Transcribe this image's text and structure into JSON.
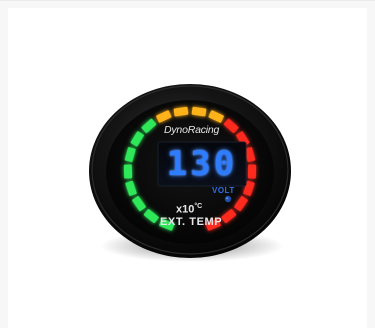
{
  "gauge": {
    "brand": "DynoRacing",
    "reading": "130",
    "unit": "VOLT",
    "scale_prefix": "x10",
    "scale_unit": "°C",
    "name": "EXT. TEMP"
  },
  "colors": {
    "segment_green": "#2ee85a",
    "segment_yellow": "#ffb21a",
    "segment_red": "#ff2a1e",
    "display_blue": "#2e7cff",
    "bezel": "#0d0d0d"
  },
  "segments": [
    {
      "zone": "green"
    },
    {
      "zone": "green"
    },
    {
      "zone": "green"
    },
    {
      "zone": "green"
    },
    {
      "zone": "green"
    },
    {
      "zone": "green"
    },
    {
      "zone": "green"
    },
    {
      "zone": "green"
    },
    {
      "zone": "yellow"
    },
    {
      "zone": "yellow"
    },
    {
      "zone": "yellow"
    },
    {
      "zone": "yellow"
    },
    {
      "zone": "red"
    },
    {
      "zone": "red"
    },
    {
      "zone": "red"
    },
    {
      "zone": "red"
    },
    {
      "zone": "red"
    },
    {
      "zone": "red"
    },
    {
      "zone": "red"
    },
    {
      "zone": "red"
    }
  ]
}
